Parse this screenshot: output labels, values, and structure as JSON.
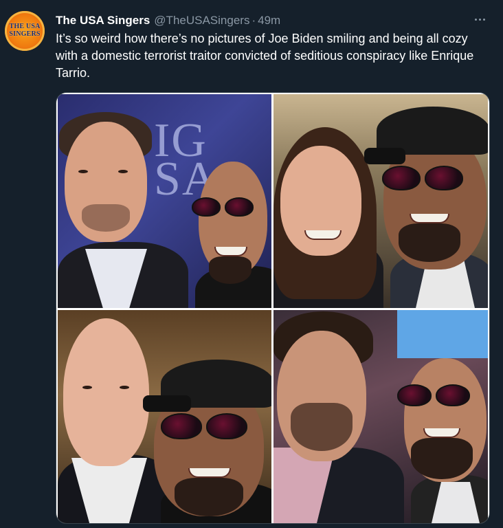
{
  "tweet": {
    "avatar": {
      "label": "THE USA\nSINGERS",
      "colors": {
        "fill": "#f07c10",
        "text": "#1a2a6e"
      }
    },
    "author": {
      "display_name": "The USA Singers",
      "handle": "@TheUSASingers"
    },
    "separator": "·",
    "time": "49m",
    "more_icon": "more-horizontal-icon",
    "text": "It’s so weird how there’s no pictures of Joe Biden smiling and being all cozy with a domestic terrorist traitor convicted of seditious conspiracy like Enrique Tarrio.",
    "media": {
      "layout": "2x2 photo grid",
      "panel_background_text": "IG\nSA"
    }
  },
  "theme": {
    "background": "#15202b",
    "text_primary": "#ffffff",
    "text_secondary": "#8b98a5",
    "border": "#38444d"
  }
}
